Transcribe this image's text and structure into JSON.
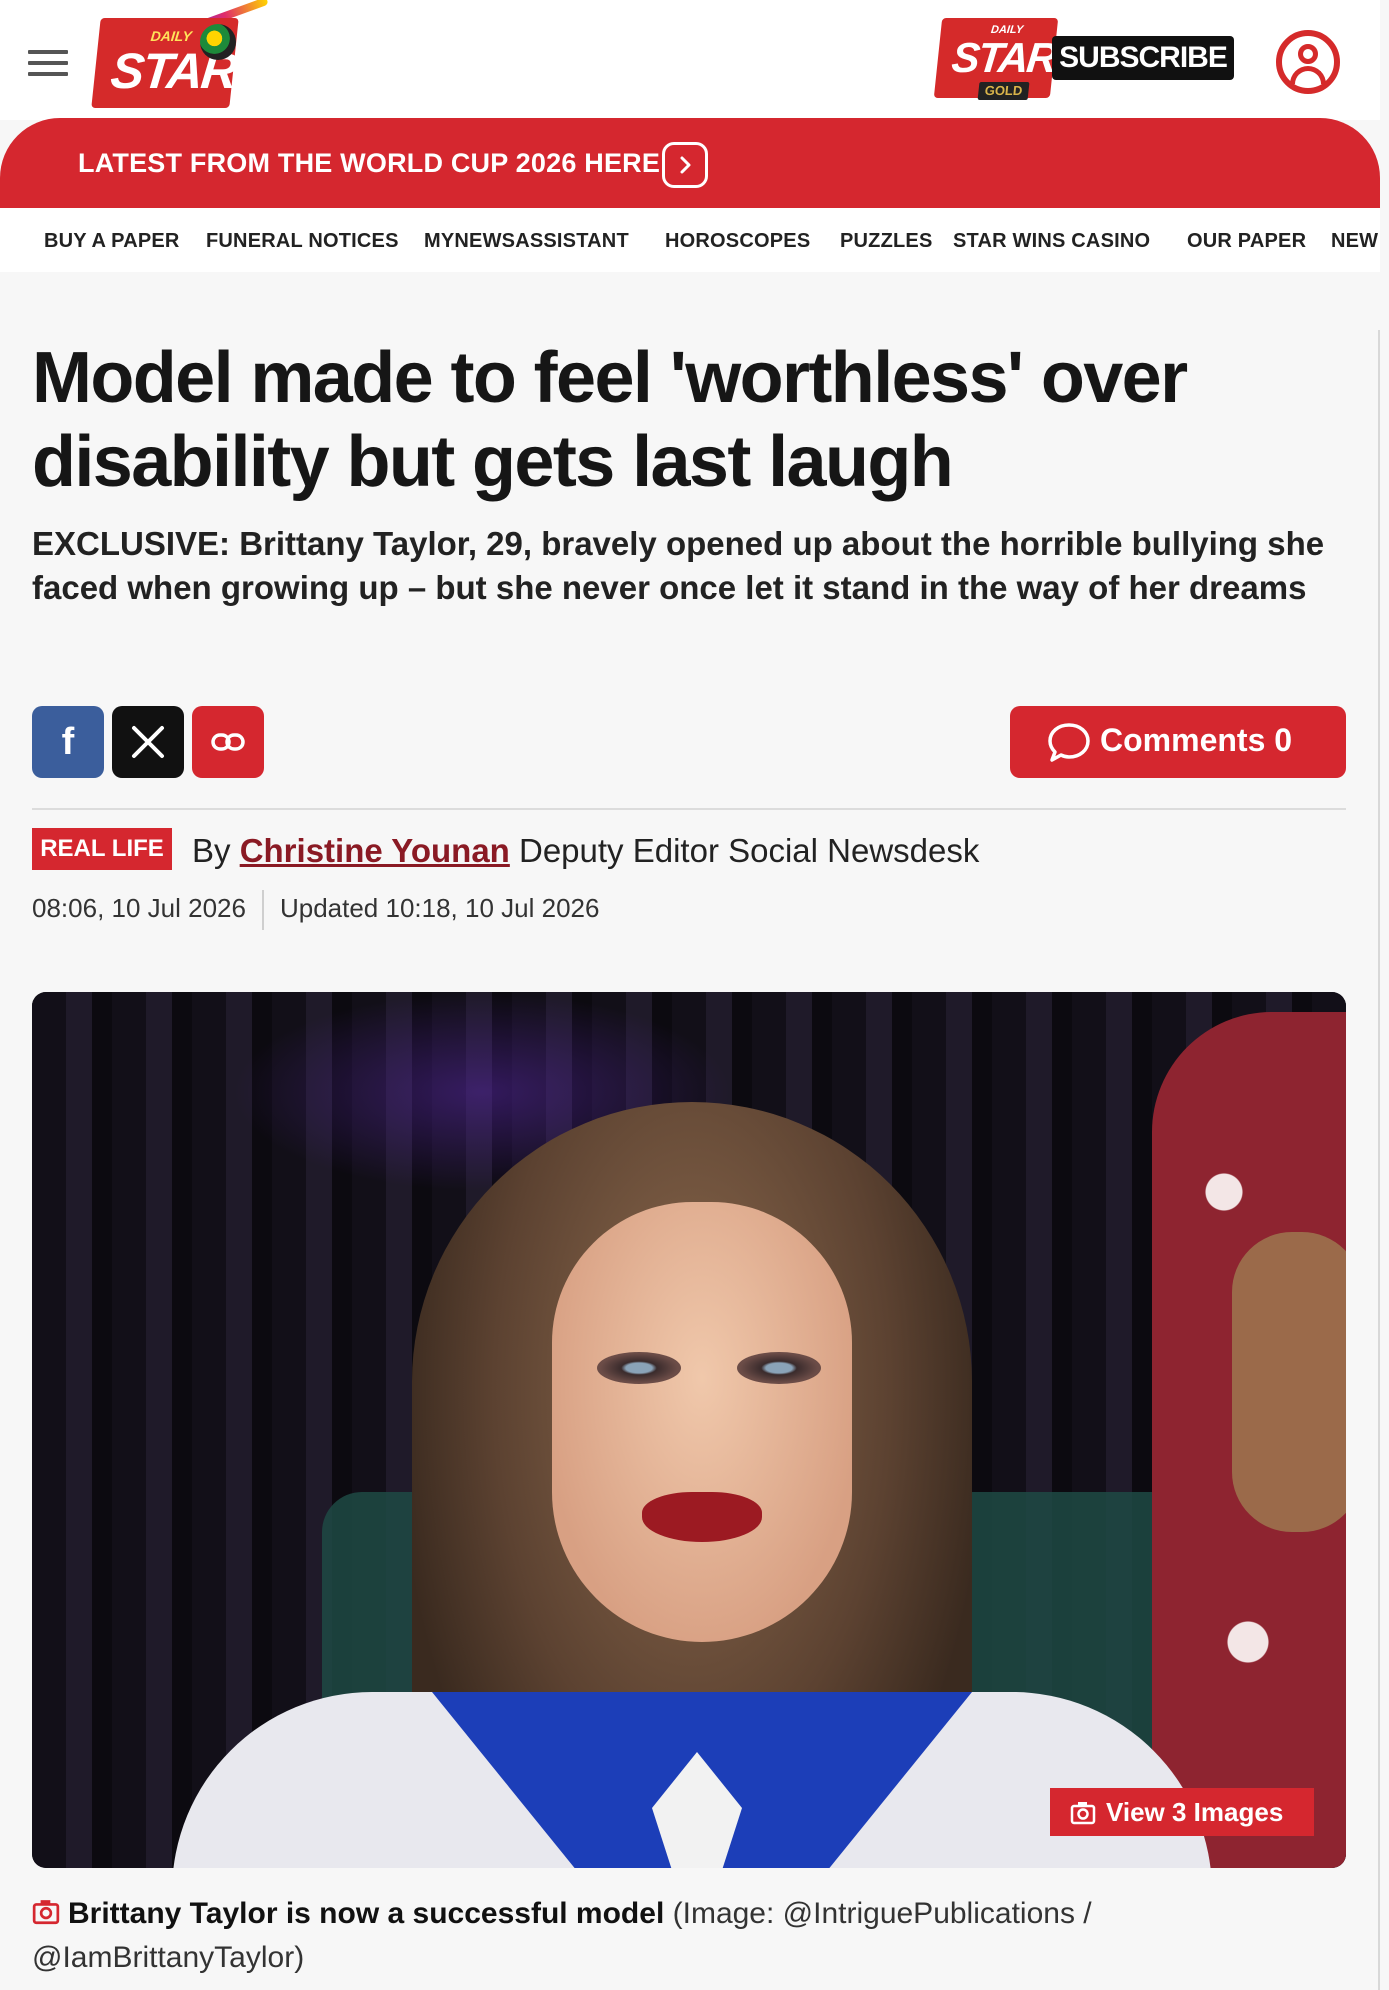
{
  "header": {
    "logo_text": {
      "daily": "DAILY",
      "star": "STAR"
    },
    "gold_logo": {
      "daily": "DAILY",
      "star": "STAR",
      "gold": "GOLD"
    },
    "subscribe_label": "SUBSCRIBE",
    "menu_icon": "hamburger-icon",
    "account_icon": "user-account-icon"
  },
  "banner": {
    "text": "LATEST FROM THE WORLD CUP 2026 HERE",
    "icon": "chevron-right-icon",
    "color": "#d5272f"
  },
  "nav": {
    "items": [
      "BUY A PAPER",
      "FUNERAL NOTICES",
      "MYNEWSASSISTANT",
      "HOROSCOPES",
      "PUZZLES",
      "STAR WINS CASINO",
      "OUR PAPER",
      "NEW"
    ]
  },
  "article": {
    "headline": "Model made to feel 'worthless' over disability but gets last laugh",
    "standfirst": "EXCLUSIVE: Brittany Taylor, 29, bravely opened up about the horrible bullying she faced when growing up – but she never once let it stand in the way of her dreams",
    "share": {
      "facebook_glyph": "f",
      "facebook_icon": "facebook-icon",
      "x_icon": "x-icon",
      "link_icon": "link-icon"
    },
    "comments_label": "Comments 0",
    "tag": "REAL LIFE",
    "byline_prefix": "By",
    "author": "Christine Younan",
    "author_role": "Deputy Editor Social Newsdesk",
    "published": "08:06, 10 Jul 2026",
    "updated": "Updated 10:18, 10 Jul 2026",
    "image": {
      "view_label": "View 3 Images",
      "caption_main": "Brittany Taylor is now a successful model",
      "caption_credit": "(Image: @IntriguePublications / @IamBrittanyTaylor)"
    }
  },
  "colors": {
    "brand_red": "#d5272f",
    "author_link": "#8a1a24",
    "facebook": "#3b5e9c"
  }
}
